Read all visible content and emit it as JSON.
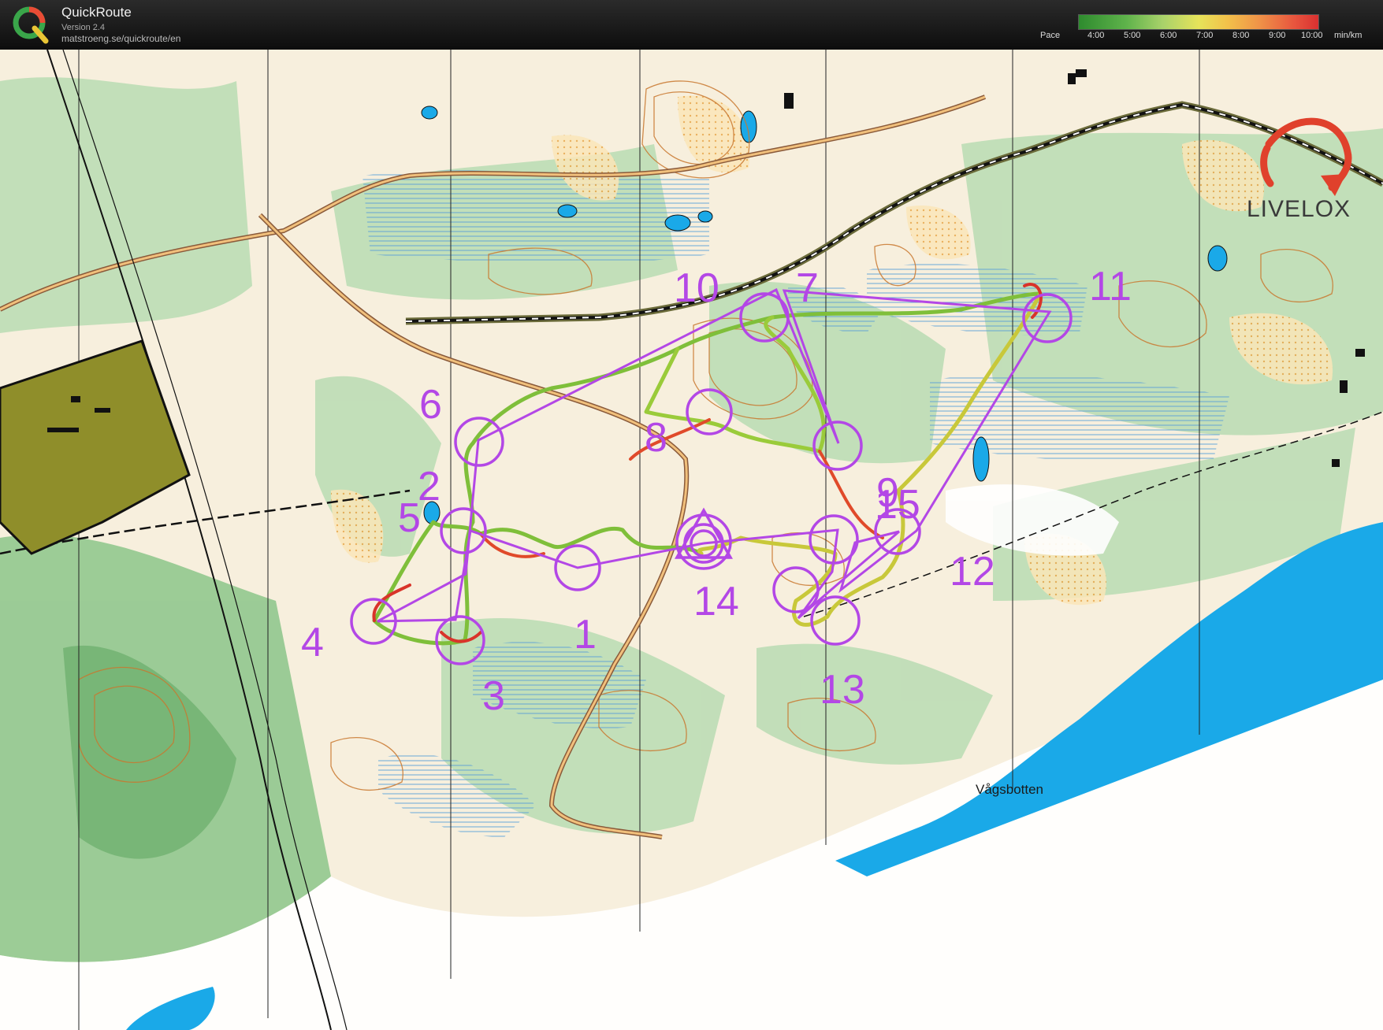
{
  "app": {
    "name": "QuickRoute",
    "version": "Version 2.4",
    "url": "matstroeng.se/quickroute/en",
    "logo_letter": "Q"
  },
  "pace_legend": {
    "label": "Pace",
    "ticks": [
      "4:00",
      "5:00",
      "6:00",
      "7:00",
      "8:00",
      "9:00",
      "10:00"
    ],
    "unit": "min/km",
    "colors": [
      "#2e8b2e",
      "#a9d26a",
      "#e6e35a",
      "#f09448",
      "#d93030"
    ]
  },
  "watermark": {
    "text": "LIVELOX",
    "accent": "#e0412c"
  },
  "map": {
    "place_name": "Vågsbotten",
    "course_color": "#b347e6",
    "controls": [
      {
        "label": "1"
      },
      {
        "label": "2"
      },
      {
        "label": "3"
      },
      {
        "label": "4"
      },
      {
        "label": "5"
      },
      {
        "label": "6"
      },
      {
        "label": "7"
      },
      {
        "label": "8"
      },
      {
        "label": "9"
      },
      {
        "label": "10"
      },
      {
        "label": "11"
      },
      {
        "label": "12"
      },
      {
        "label": "13"
      },
      {
        "label": "14"
      },
      {
        "label": "15"
      }
    ]
  }
}
